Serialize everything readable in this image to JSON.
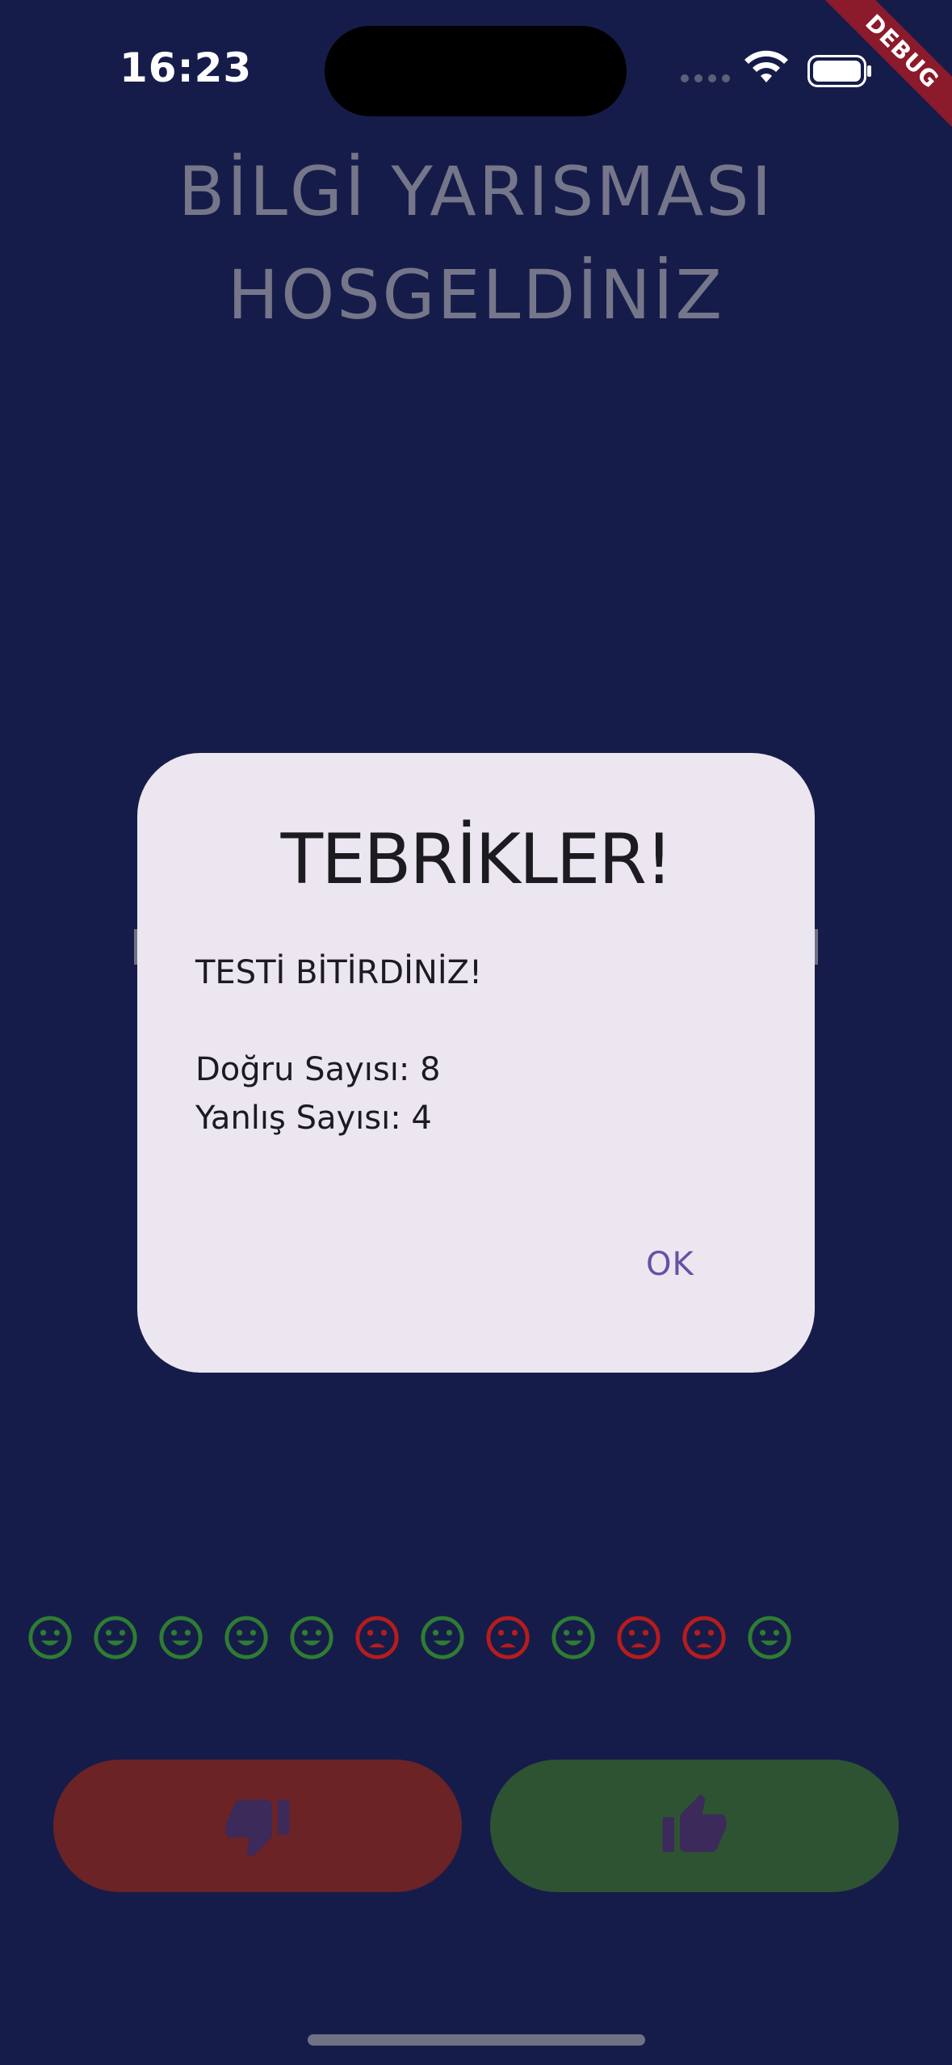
{
  "status_bar": {
    "time": "16:23"
  },
  "debug_banner": "DEBUG",
  "header": {
    "line1": "BİLGİ YARISMASI",
    "line2": "HOSGELDİNİZ"
  },
  "dialog": {
    "title": "TEBRİKLER!",
    "message": "TESTİ BİTİRDİNİZ!",
    "correct": "Doğru Sayısı: 8",
    "wrong": "Yanlış Sayısı: 4",
    "ok_label": "OK"
  },
  "results": [
    "happy",
    "happy",
    "happy",
    "happy",
    "happy",
    "sad",
    "happy",
    "sad",
    "happy",
    "sad",
    "sad",
    "happy"
  ],
  "colors": {
    "background": "#161c4a",
    "happy": "#2e7d32",
    "sad": "#b71c1c",
    "false_button": "#6b2326",
    "true_button": "#2e5332",
    "dialog_bg": "#ece6f0",
    "accent": "#6750a4"
  },
  "icons": {
    "false_button": "thumb-down-icon",
    "true_button": "thumb-up-icon"
  }
}
